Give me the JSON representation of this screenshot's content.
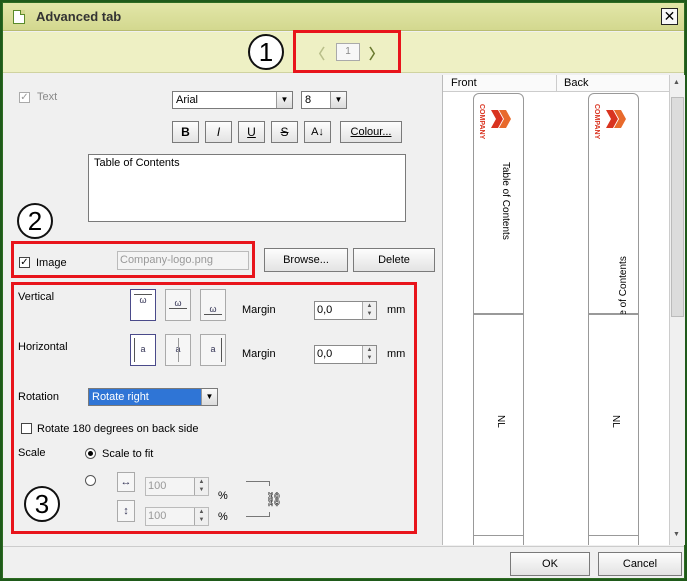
{
  "window": {
    "title": "Advanced tab",
    "close_glyph": "✕"
  },
  "nav": {
    "prev_glyph": "〈",
    "next_glyph": "〉",
    "page": "1"
  },
  "callouts": [
    "1",
    "2",
    "3"
  ],
  "text_section": {
    "text_label": "Text",
    "text_checked": true,
    "font_family": "Arial",
    "font_size": "8",
    "bold": "B",
    "italic": "I",
    "underline": "U",
    "strike": "S",
    "size_toggle": "A↓",
    "colour": "Colour...",
    "content": "Table of Contents"
  },
  "image_section": {
    "image_label": "Image",
    "image_checked": true,
    "file_placeholder": "Company-logo.png",
    "browse": "Browse...",
    "delete": "Delete"
  },
  "position": {
    "vertical_label": "Vertical",
    "horizontal_label": "Horizontal",
    "margin_label": "Margin",
    "vertical_margin": "0,0",
    "horizontal_margin": "0,0",
    "unit": "mm",
    "rotation_label": "Rotation",
    "rotation_value": "Rotate right",
    "rotate_back_label": "Rotate 180 degrees on back side",
    "scale_label": "Scale",
    "scale_to_fit_label": "Scale to fit",
    "width_pct": "100",
    "height_pct": "100",
    "pct_unit": "%"
  },
  "preview": {
    "front_label": "Front",
    "back_label": "Back",
    "company_text": "COMPANY",
    "tab_text": "Table of Contents",
    "lang_text": "NL"
  },
  "footer": {
    "ok": "OK",
    "cancel": "Cancel"
  },
  "colors": {
    "title_bar": "#d3d88f",
    "highlight_border": "#e8141b",
    "logo": "#d9331f"
  }
}
